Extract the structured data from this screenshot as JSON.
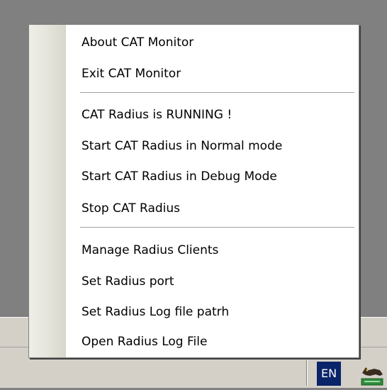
{
  "menu": {
    "group1": [
      {
        "label": "About CAT Monitor"
      },
      {
        "label": "Exit CAT Monitor"
      }
    ],
    "group2": [
      {
        "label": "CAT Radius is RUNNING !"
      },
      {
        "label": "Start CAT Radius in Normal mode"
      },
      {
        "label": "Start CAT Radius in Debug Mode"
      },
      {
        "label": "Stop CAT Radius"
      }
    ],
    "group3": [
      {
        "label": "Manage Radius Clients"
      },
      {
        "label": "Set Radius port"
      },
      {
        "label": "Set Radius Log file patrh"
      },
      {
        "label": "Open Radius Log File"
      }
    ]
  },
  "taskbar": {
    "language_indicator": "EN",
    "tray_icon": "cat-monitor-tray-icon"
  },
  "colors": {
    "desktop": "#808080",
    "taskbar": "#d4d0c8",
    "menu_background": "#ffffff",
    "menu_gutter": "#e3e3da",
    "language_indicator_bg": "#0a246a"
  }
}
